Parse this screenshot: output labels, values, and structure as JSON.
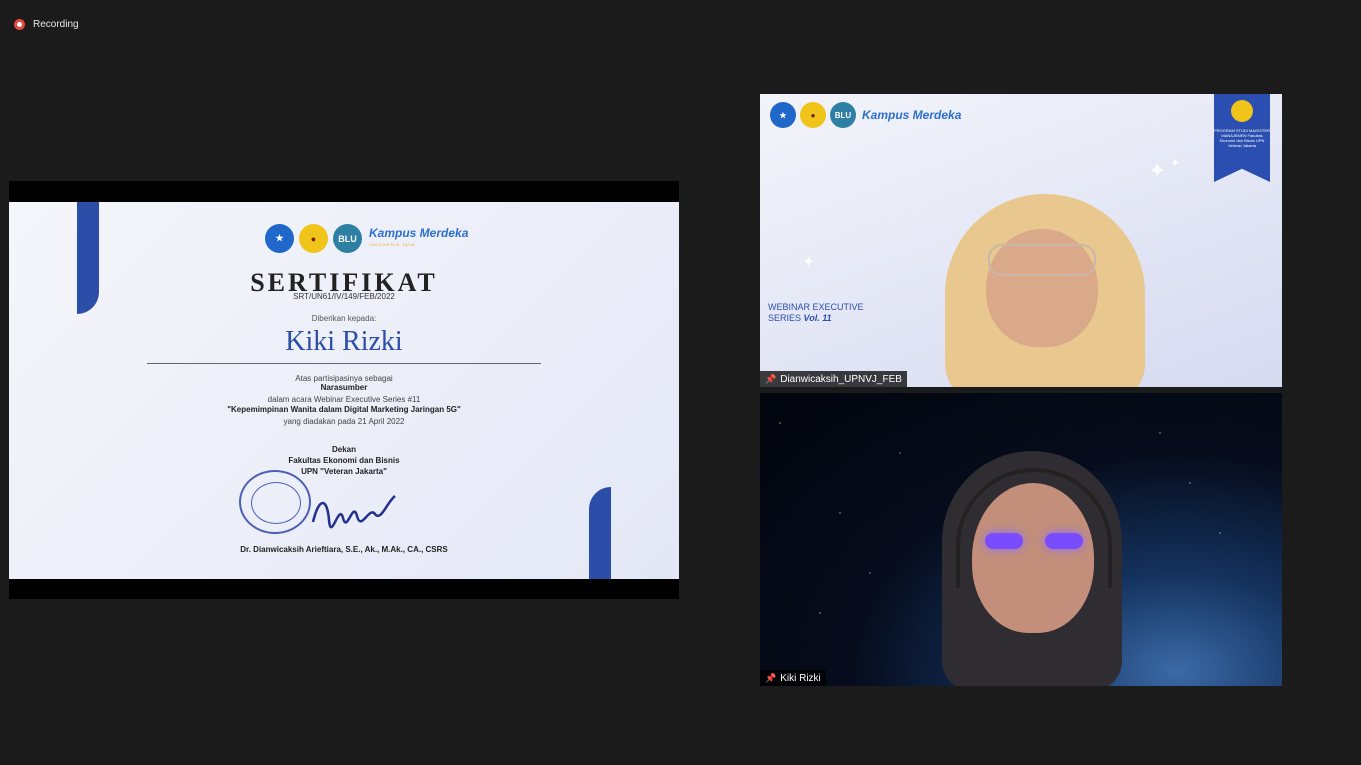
{
  "recording": {
    "label": "Recording"
  },
  "share": {
    "logos": {
      "blu": "BLU",
      "kampus": "Kampus Merdeka",
      "kampus_sub": "INDONESIA JAYA"
    },
    "title": "SERTIFIKAT",
    "number": "SRT/UN61/IV/149/FEB/2022",
    "given_to": "Diberikan kepada:",
    "recipient": "Kiki Rizki",
    "participation": "Atas partisipasinya sebagai",
    "role": "Narasumber",
    "event_intro": "dalam acara Webinar Executive Series #11",
    "event_title": "\"Kepemimpinan Wanita dalam Digital Marketing Jaringan 5G\"",
    "event_date": "yang diadakan pada 21 April 2022",
    "signer_title": "Dekan",
    "faculty": "Fakultas Ekonomi dan Bisnis",
    "university": "UPN \"Veteran Jakarta\"",
    "signer_name": "Dr. Dianwicaksih Arieftiara, S.E., Ak., M.Ak., CA., CSRS"
  },
  "participants": [
    {
      "name": "Dianwicaksih_UPNVJ_FEB",
      "bg": {
        "blu": "BLU",
        "kampus": "Kampus Merdeka",
        "banner": "PROGRAM STUDI MAGISTER MANAJEMEN Fakultas Ekonomi dan Bisnis UPN Veteran Jakarta",
        "webinar_line1": "WEBINAR EXECUTIVE",
        "webinar_line2": "SERIES",
        "webinar_vol": "Vol. 11"
      }
    },
    {
      "name": "Kiki Rizki"
    }
  ]
}
